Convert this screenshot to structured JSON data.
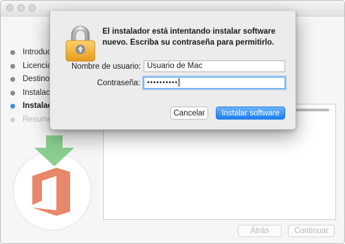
{
  "installer": {
    "steps": [
      {
        "label": "Introducción",
        "state": "done"
      },
      {
        "label": "Licencia",
        "state": "done"
      },
      {
        "label": "Destino",
        "state": "done"
      },
      {
        "label": "Instalación",
        "state": "done"
      },
      {
        "label": "Instalación",
        "state": "active"
      },
      {
        "label": "Resumen",
        "state": "future"
      }
    ],
    "back_label": "Atrás",
    "continue_label": "Continuar",
    "logo_icon": "office-logo-icon",
    "arrow_icon": "download-arrow-icon"
  },
  "dialog": {
    "message": "El instalador está intentando instalar software nuevo. Escriba su contraseña para permitirlo.",
    "username_label": "Nombre de usuario:",
    "username_value": "Usuario de Mac",
    "password_label": "Contraseña:",
    "password_value": "••••••••••",
    "cancel_label": "Cancelar",
    "install_label": "Instalar software",
    "lock_icon": "lock-icon"
  },
  "colors": {
    "accent": "#1c7ef3",
    "office_orange": "#e8876a",
    "arrow_green": "#8bcf8f",
    "lock_gold": "#f3b23a"
  }
}
